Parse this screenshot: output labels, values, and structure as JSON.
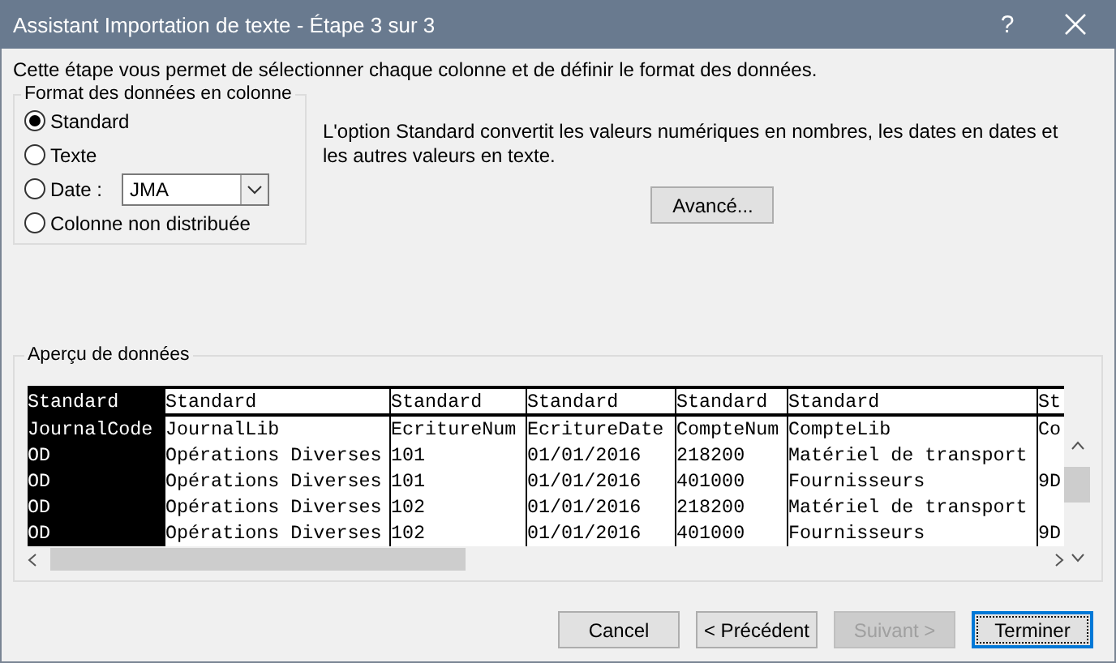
{
  "window": {
    "title": "Assistant Importation de texte - Étape 3 sur 3",
    "help": "?"
  },
  "intro": "Cette étape vous permet de sélectionner chaque colonne et de définir le format des données.",
  "format": {
    "title": "Format des données en colonne",
    "options": [
      {
        "label": "Standard",
        "selected": true,
        "kind": "plain"
      },
      {
        "label": "Texte",
        "selected": false,
        "kind": "plain"
      },
      {
        "label": "Date :",
        "selected": false,
        "kind": "date",
        "value": "JMA"
      },
      {
        "label": "Colonne non distribuée",
        "selected": false,
        "kind": "plain"
      }
    ]
  },
  "description": "L'option Standard convertit les valeurs numériques en nombres, les dates en dates et les autres valeurs en texte.",
  "advanced_button": "Avancé...",
  "preview": {
    "title": "Aperçu de données",
    "columns": [
      {
        "header": "Standard",
        "selected": true
      },
      {
        "header": "Standard",
        "selected": false
      },
      {
        "header": "Standard",
        "selected": false
      },
      {
        "header": "Standard",
        "selected": false
      },
      {
        "header": "Standard",
        "selected": false
      },
      {
        "header": "Standard",
        "selected": false
      },
      {
        "header": "St",
        "selected": false
      }
    ],
    "rows": [
      [
        "JournalCode",
        "JournalLib",
        "EcritureNum",
        "EcritureDate",
        "CompteNum",
        "CompteLib",
        "Co"
      ],
      [
        "OD",
        "Opérations Diverses",
        "101",
        "01/01/2016",
        "218200",
        "Matériel de transport",
        null
      ],
      [
        "OD",
        "Opérations Diverses",
        "101",
        "01/01/2016",
        "401000",
        "Fournisseurs",
        "9D"
      ],
      [
        "OD",
        "Opérations Diverses",
        "102",
        "01/01/2016",
        "218200",
        "Matériel de transport",
        null
      ],
      [
        "OD",
        "Opérations Diverses",
        "102",
        "01/01/2016",
        "401000",
        "Fournisseurs",
        "9D"
      ]
    ]
  },
  "buttons": [
    {
      "label": "Cancel",
      "disabled": false,
      "default": false
    },
    {
      "label": "< Précédent",
      "disabled": false,
      "default": false
    },
    {
      "label": "Suivant >",
      "disabled": true,
      "default": false
    },
    {
      "label": "Terminer",
      "disabled": false,
      "default": true
    }
  ]
}
